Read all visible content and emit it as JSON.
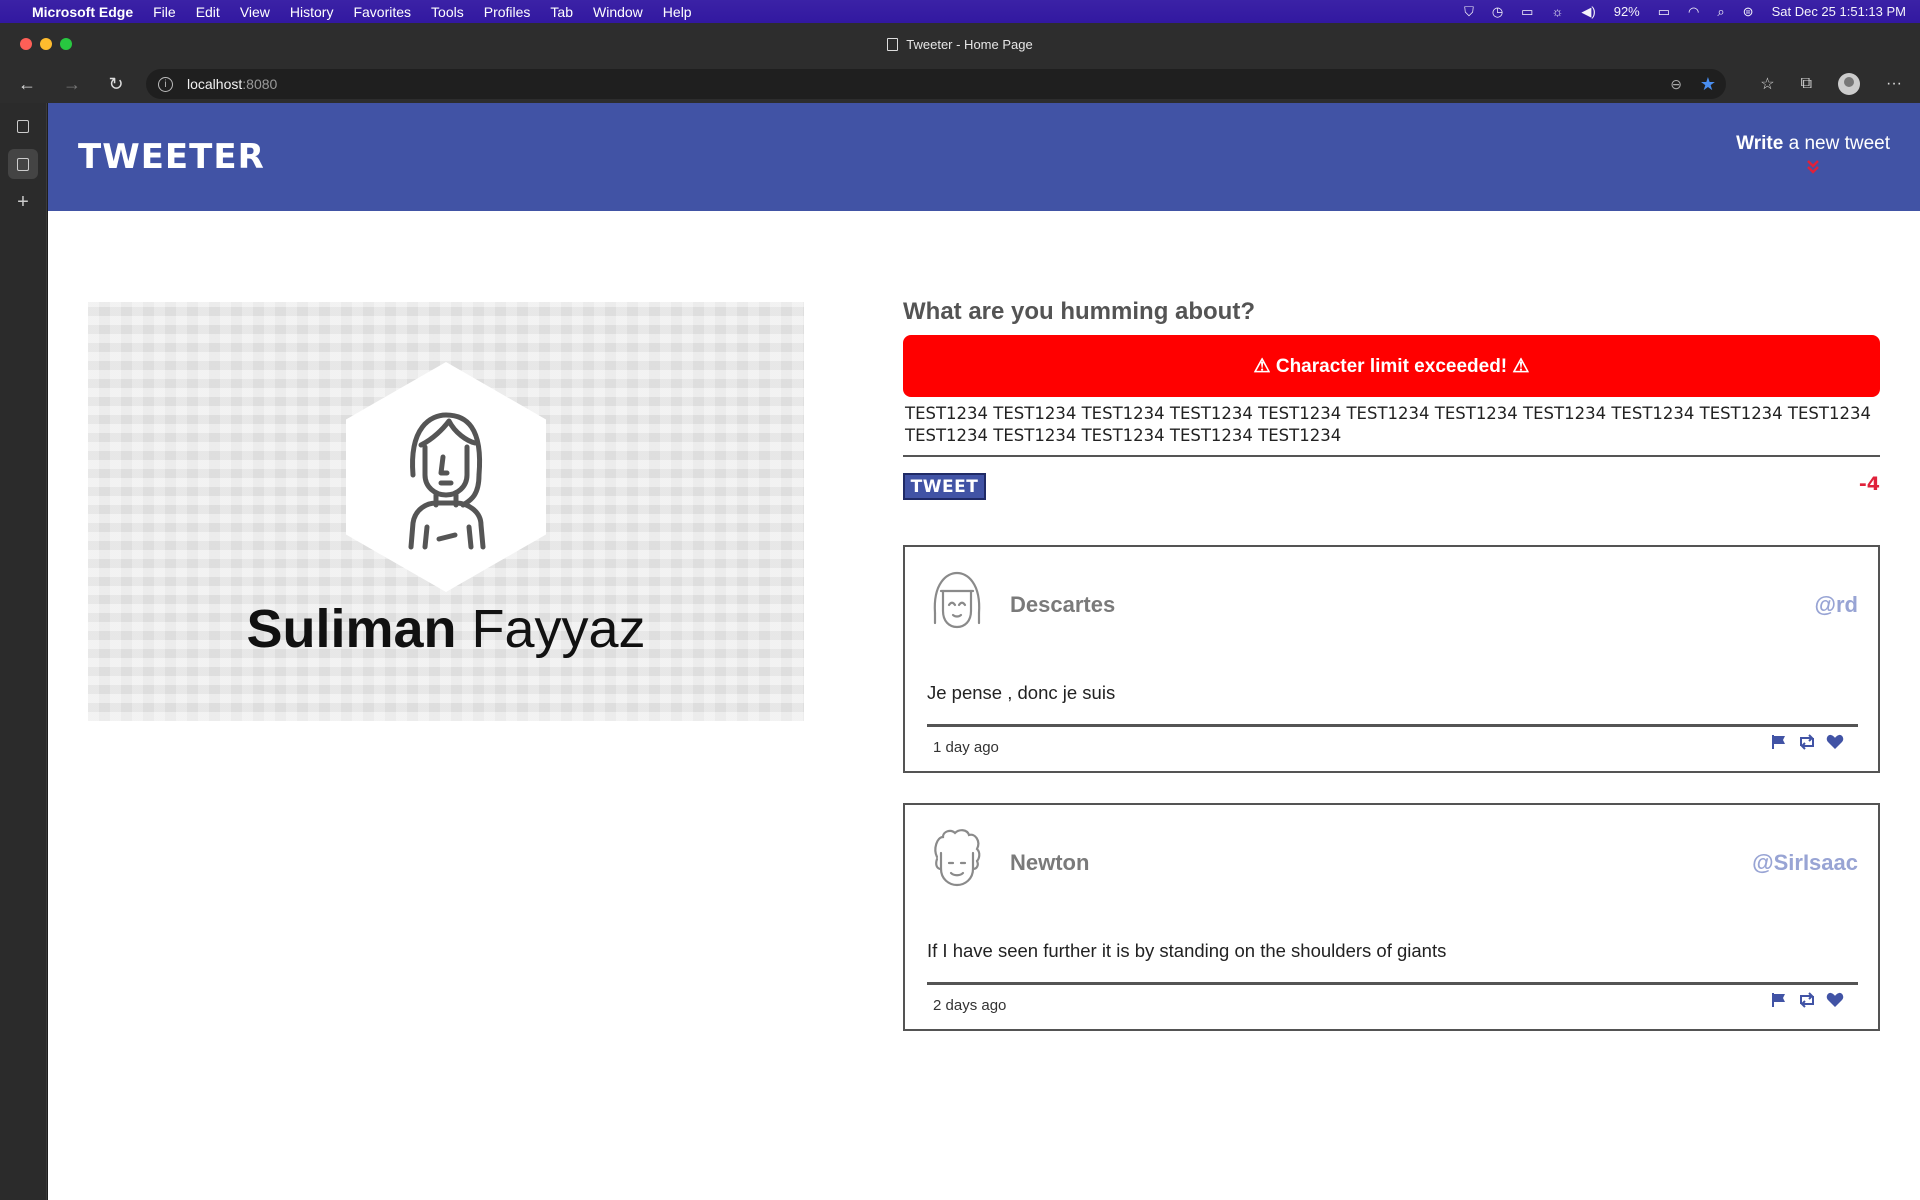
{
  "menubar": {
    "app_name": "Microsoft Edge",
    "items": [
      "File",
      "Edit",
      "View",
      "History",
      "Favorites",
      "Tools",
      "Profiles",
      "Tab",
      "Window",
      "Help"
    ],
    "battery": "92%",
    "datetime": "Sat Dec 25  1:51:13 PM"
  },
  "window": {
    "title": "Tweeter - Home Page"
  },
  "address_bar": {
    "host": "localhost",
    "port": ":8080"
  },
  "site": {
    "logo": "TWEETER",
    "compose_toggle_bold": "Write",
    "compose_toggle_rest": " a new tweet",
    "compose_toggle_chevron": "»"
  },
  "profile": {
    "first_name": "Suliman",
    "last_name": "Fayyaz"
  },
  "composer": {
    "question": "What are you humming about?",
    "error": "⚠ Character limit exceeded! ⚠",
    "text": "TEST1234 TEST1234 TEST1234 TEST1234 TEST1234 TEST1234 TEST1234 TEST1234 TEST1234 TEST1234 TEST1234 TEST1234 TEST1234 TEST1234 TEST1234 TEST1234",
    "button": "TWEET",
    "counter": "-4"
  },
  "tweets": [
    {
      "author": "Descartes",
      "handle": "@rd",
      "content": "Je pense , donc je suis",
      "time": "1 day ago"
    },
    {
      "author": "Newton",
      "handle": "@SirIsaac",
      "content": "If I have seen further it is by standing on the shoulders of giants",
      "time": "2 days ago"
    }
  ],
  "colors": {
    "nav": "#4153a5",
    "error": "#ff0000",
    "counter": "#e0213a"
  }
}
